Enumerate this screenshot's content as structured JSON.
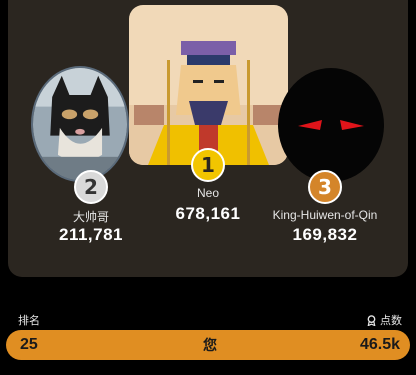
{
  "podium": [
    {
      "rank": "2",
      "name": "大帅哥",
      "points": "211,781",
      "avatar": "batman-cat-avatar",
      "badge_color": "#d9d9d9"
    },
    {
      "rank": "1",
      "name": "Neo",
      "points": "678,161",
      "avatar": "emperor-avatar",
      "badge_color": "#f2c500"
    },
    {
      "rank": "3",
      "name": "King-Huiwen-of-Qin",
      "points": "169,832",
      "avatar": "red-eyes-avatar",
      "badge_color": "#d4852a"
    }
  ],
  "list_header": {
    "rank_label": "排名",
    "points_label": "点数",
    "points_icon": "medal-icon"
  },
  "current_user": {
    "rank": "25",
    "label": "您",
    "points": "46.5k"
  },
  "colors": {
    "panel": "#2b2620",
    "accent": "#e08e22",
    "background": "#000000"
  }
}
